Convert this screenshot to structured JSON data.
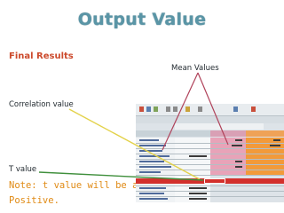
{
  "title": "Output Value",
  "labels": {
    "final_results": "Final Results",
    "mean_values": "Mean Values",
    "correlation_value": "Correlation value",
    "t_value": "T value"
  },
  "note": {
    "line1": "Note: t value will be always in",
    "line2": "Positive."
  },
  "colors": {
    "title": "#5a95a6",
    "final_results": "#cc4a2c",
    "note": "#e08a14",
    "mean_arrow": "#b0425a",
    "correlation_arrow": "#e3d24a",
    "t_arrow": "#3f8f3c",
    "sheet_highlight_row": "#d3302c",
    "sheet_pink": "#e8a3b8",
    "sheet_orange": "#f29a3a"
  },
  "sheet": {
    "caption": "Paired Sample t-Test screenshot (unreadable)",
    "columns": [
      "Variable 1",
      "Variable 2"
    ]
  }
}
